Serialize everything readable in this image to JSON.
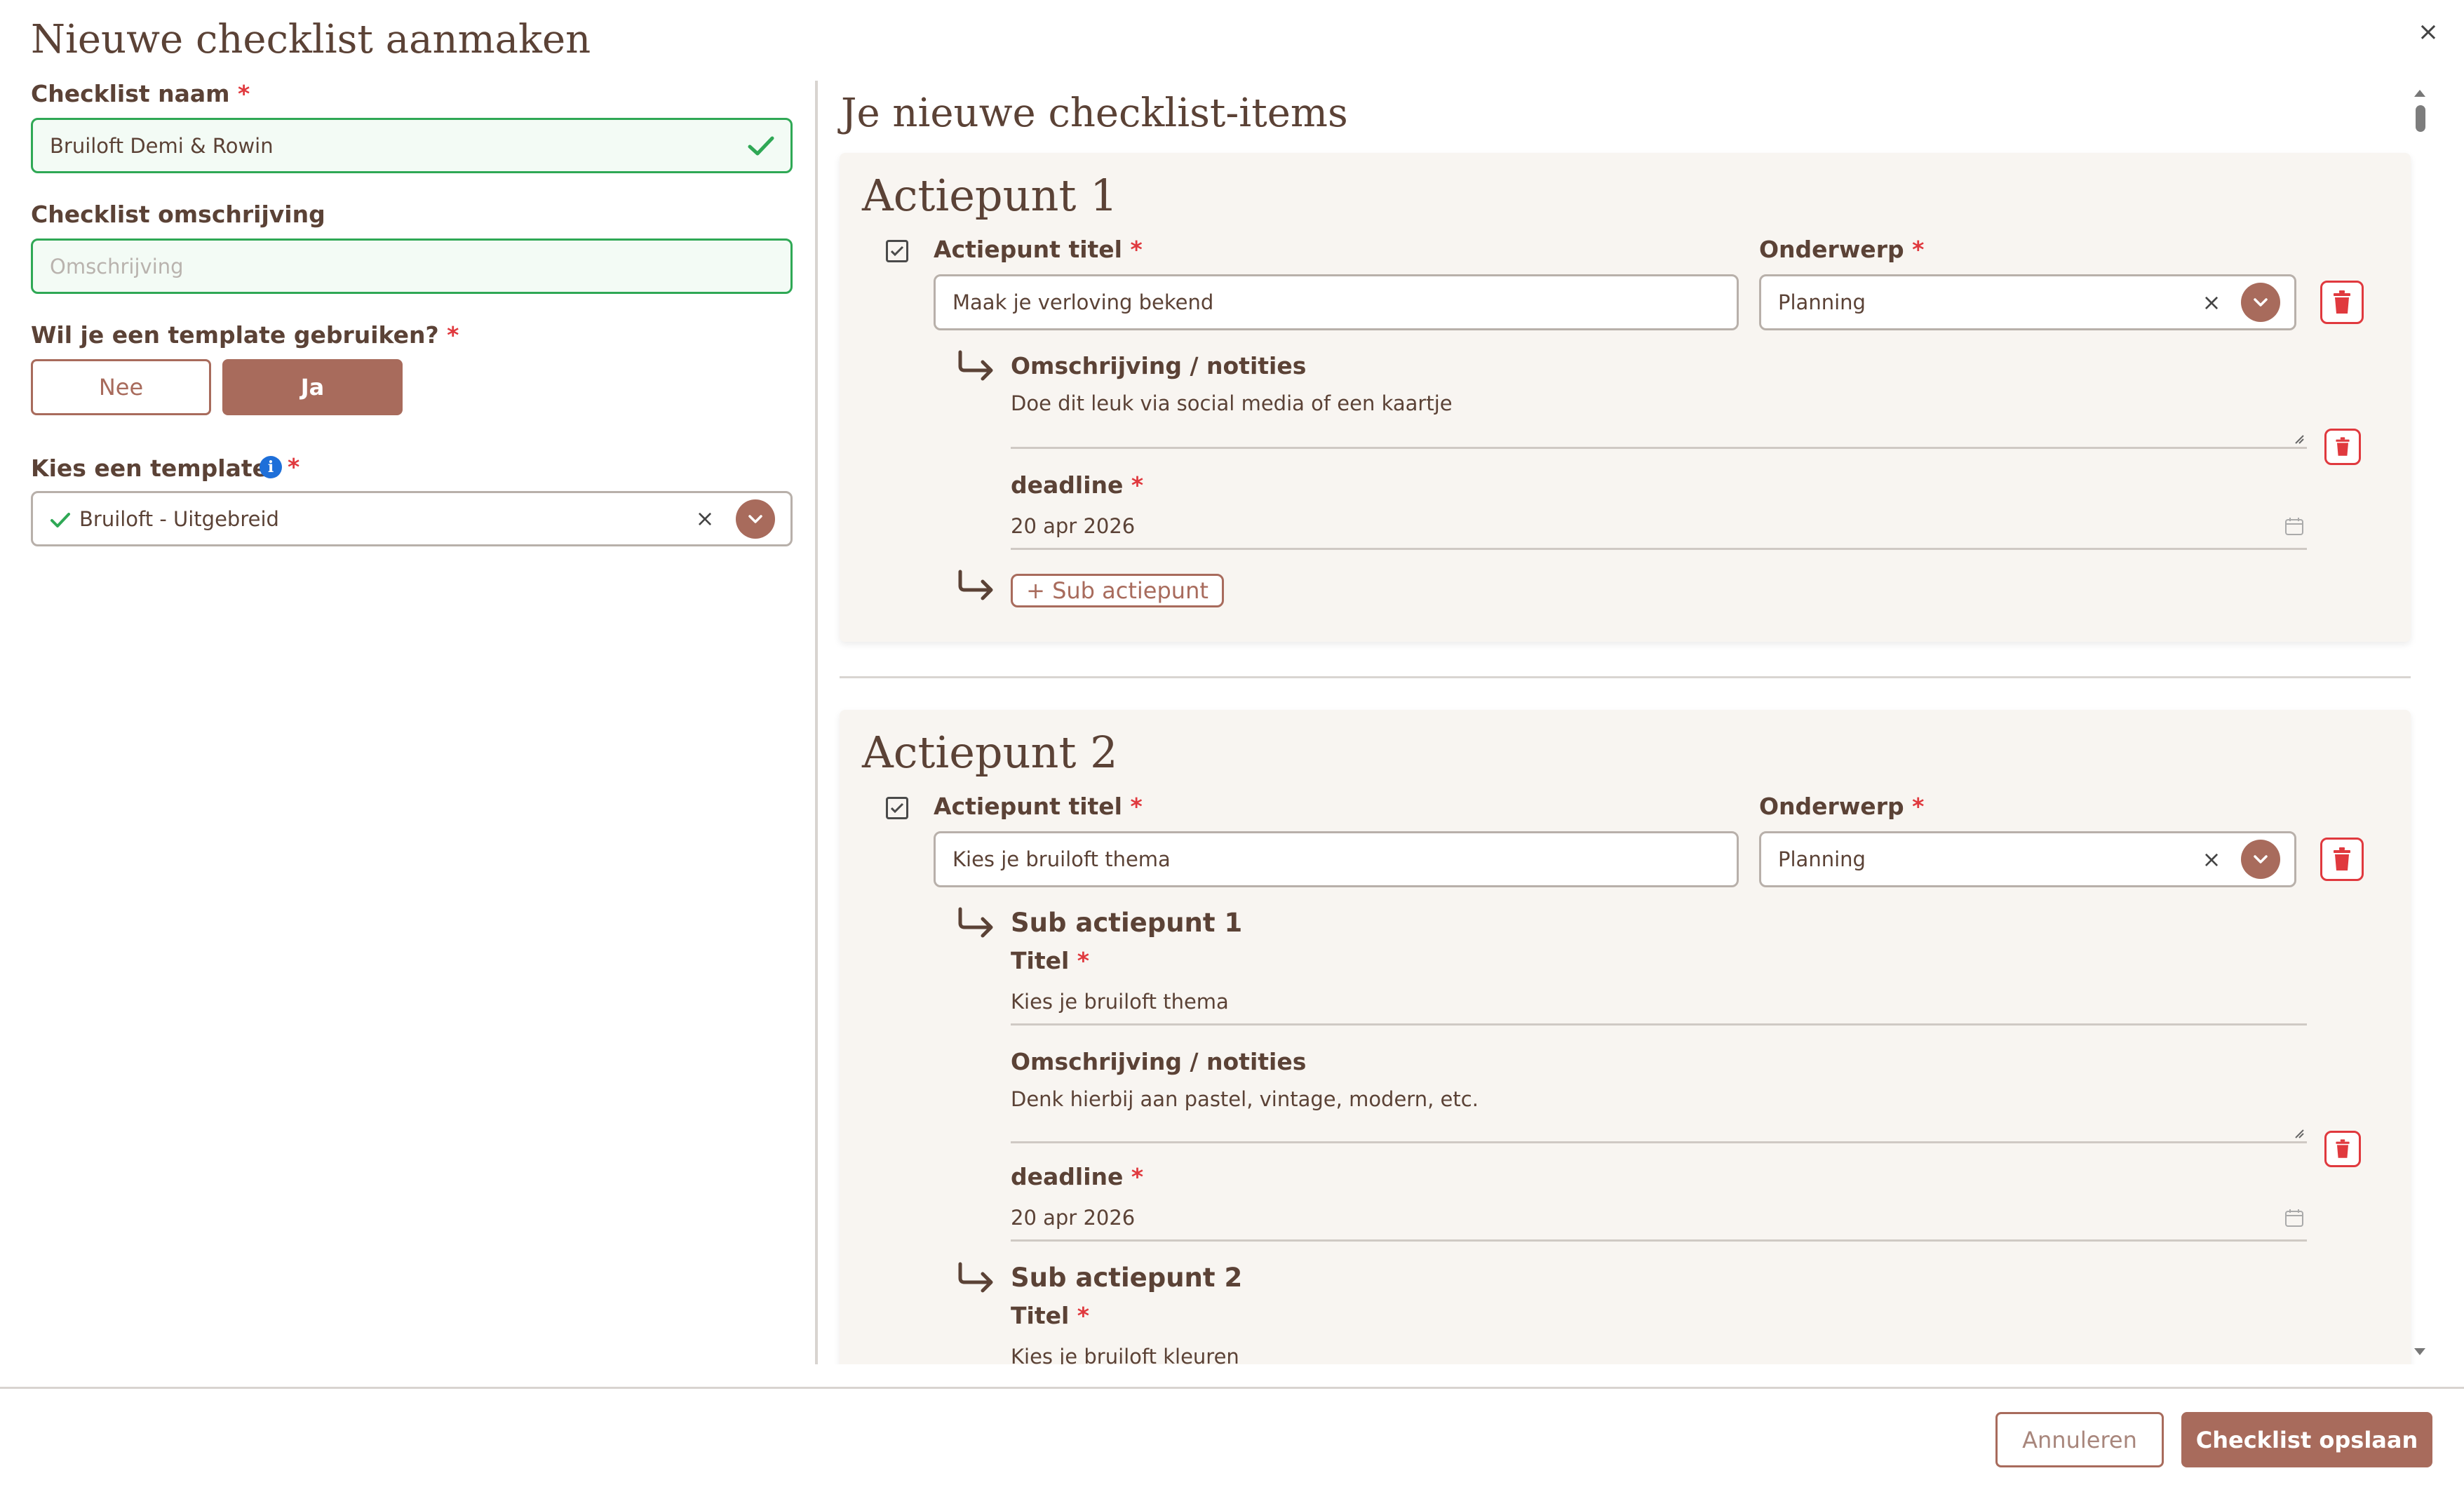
{
  "modal": {
    "title": "Nieuwe checklist aanmaken",
    "close_glyph": "×"
  },
  "form": {
    "name_label": "Checklist naam",
    "name_value": "Bruiloft Demi & Rowin",
    "description_label": "Checklist omschrijving",
    "description_placeholder": "Omschrijving",
    "template_question_label": "Wil je een template gebruiken?",
    "template_no": "Nee",
    "template_yes": "Ja",
    "choose_template_label": "Kies een template",
    "template_value": "Bruiloft - Uitgebreid",
    "required_mark": "*"
  },
  "items_section": {
    "title": "Je nieuwe checklist-items"
  },
  "actiepunt1": {
    "title": "Actiepunt 1",
    "title_label": "Actiepunt titel",
    "title_value": "Maak je verloving bekend",
    "subject_label": "Onderwerp",
    "subject_value": "Planning",
    "desc_label": "Omschrijving / notities",
    "desc_value": "Doe dit leuk via social media of een kaartje",
    "deadline_label": "deadline",
    "deadline_value": "20 apr 2026",
    "add_sub_label": "+ Sub actiepunt"
  },
  "actiepunt2": {
    "title": "Actiepunt 2",
    "title_label": "Actiepunt titel",
    "title_value": "Kies je bruiloft thema",
    "subject_label": "Onderwerp",
    "subject_value": "Planning",
    "sub1": {
      "heading": "Sub actiepunt 1",
      "title_label": "Titel",
      "title_value": "Kies je bruiloft thema",
      "desc_label": "Omschrijving / notities",
      "desc_value": "Denk hierbij aan pastel, vintage, modern, etc.",
      "deadline_label": "deadline",
      "deadline_value": "20 apr 2026"
    },
    "sub2": {
      "heading": "Sub actiepunt 2",
      "title_label": "Titel",
      "title_value": "Kies je bruiloft kleuren"
    }
  },
  "footer": {
    "cancel_label": "Annuleren",
    "save_label": "Checklist opslaan"
  },
  "colors": {
    "brand": "#a86b5c",
    "text": "#5b4236",
    "valid": "#2fa855",
    "danger": "#e0393e",
    "card_bg": "#f8f5f1"
  },
  "icons": [
    "close-icon",
    "check-icon",
    "info-icon",
    "clear-icon",
    "chevron-down-icon",
    "checkbox-icon",
    "trash-icon",
    "return-arrow-icon",
    "calendar-icon",
    "resize-handle-icon"
  ]
}
